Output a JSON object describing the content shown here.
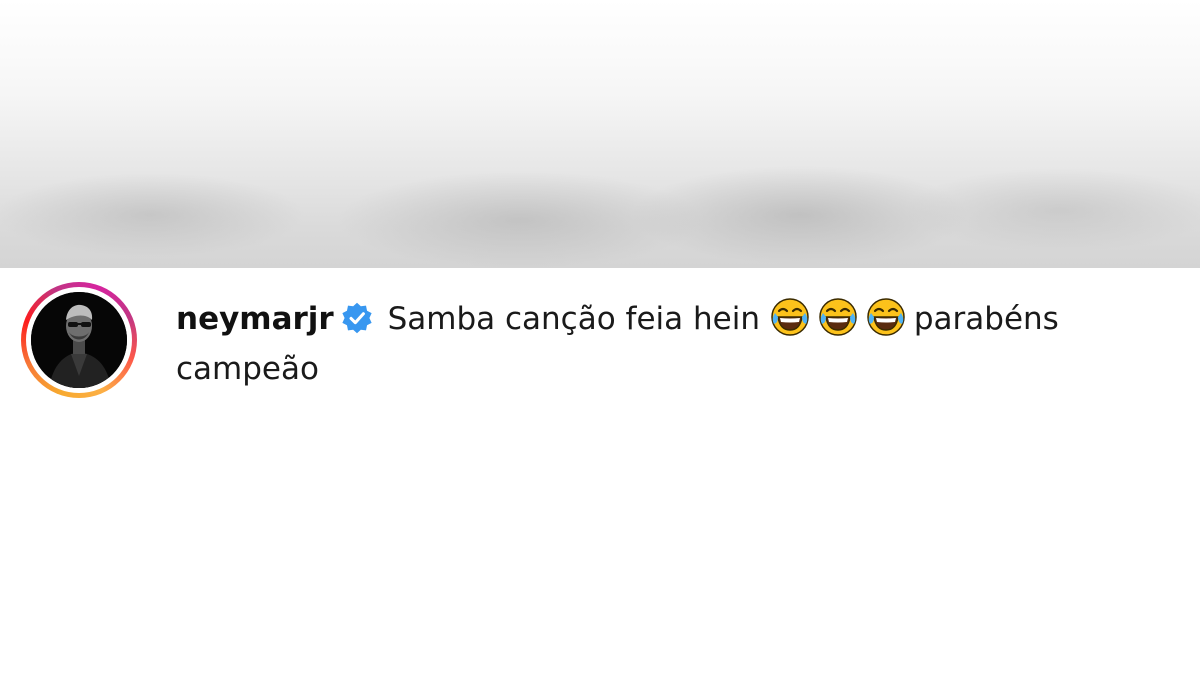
{
  "comment": {
    "username": "neymarjr",
    "verified_icon": "verified-badge-icon",
    "text_main": "Samba canção feia hein",
    "emoji_icon": "face-with-tears-of-joy-icon",
    "emoji_count": 3,
    "text_after": "parabéns campeão"
  },
  "colors": {
    "verified_blue": "#3897f0",
    "text": "#1a1a1a",
    "story_ring": [
      "#f7a92f",
      "#fd1d1d",
      "#d6249f"
    ]
  }
}
